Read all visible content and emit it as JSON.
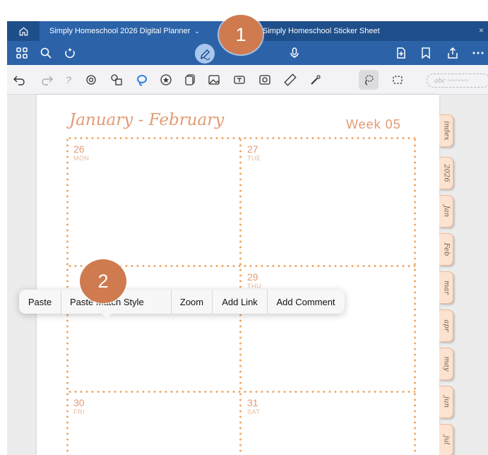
{
  "tabs": [
    {
      "label": "Simply Homeschool 2026 Digital Planner",
      "active": true
    },
    {
      "label": "Simply Homeschool Sticker Sheet",
      "active": false
    }
  ],
  "toolbar": {
    "icons": [
      "grid-icon",
      "search-icon",
      "share-sparkle-icon",
      "pen-icon",
      "microphone-icon",
      "add-page-icon",
      "bookmark-icon",
      "export-icon",
      "more-icon"
    ]
  },
  "tools": {
    "icons": [
      "undo-icon",
      "redo-icon",
      "help-icon",
      "lasso-eye-icon",
      "shapes-icon",
      "lasso-highlight-icon",
      "sticker-icon",
      "elements-icon",
      "image-icon",
      "text-box-icon",
      "camera-icon",
      "ruler-icon",
      "laser-pointer-icon",
      "lasso-icon",
      "selection-icon"
    ],
    "text_placeholder": "abc ~~~~~"
  },
  "planner": {
    "title": "January - February",
    "week": "Week 05",
    "days": [
      {
        "num": "26",
        "name": "MON"
      },
      {
        "num": "27",
        "name": "TUE"
      },
      {
        "num": "29",
        "name": "THU"
      },
      {
        "num": "30",
        "name": "FRI"
      },
      {
        "num": "31",
        "name": "SAT"
      }
    ],
    "side_tabs": [
      "index",
      "2026",
      "Jan",
      "Feb",
      "mar",
      "apr",
      "may",
      "jun",
      "jul"
    ]
  },
  "context_menu": [
    "Paste",
    "Paste Match Style",
    "Zoom",
    "Add Link",
    "Add Comment"
  ],
  "menu_visible": {
    "paste_partial": "Past",
    "match_partial": "atch Style"
  },
  "badges": [
    "1",
    "2"
  ],
  "colors": {
    "tab_bar": "#1f4f8a",
    "toolbar": "#2c63a8",
    "accent": "#e39a73",
    "dots": "#f0a561",
    "badge": "#cf7a4f"
  }
}
